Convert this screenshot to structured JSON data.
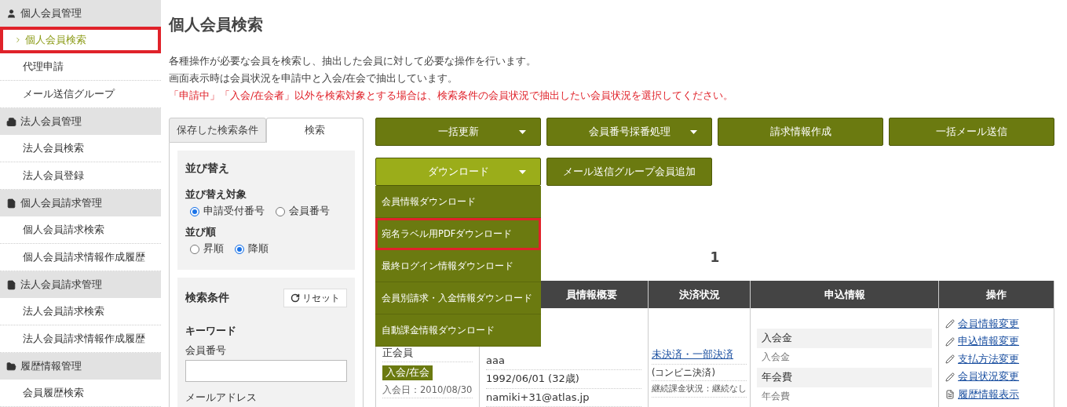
{
  "sidebar": {
    "groups": [
      {
        "label": "個人会員管理",
        "items": [
          {
            "label": "個人会員検索",
            "selected": true,
            "highlighted": true
          },
          {
            "label": "代理申請",
            "selected": false,
            "highlighted": false
          },
          {
            "label": "メール送信グループ",
            "selected": false,
            "highlighted": false
          }
        ]
      },
      {
        "label": "法人会員管理",
        "items": [
          {
            "label": "法人会員検索",
            "selected": false,
            "highlighted": false
          },
          {
            "label": "法人会員登録",
            "selected": false,
            "highlighted": false
          }
        ]
      },
      {
        "label": "個人会員請求管理",
        "items": [
          {
            "label": "個人会員請求検索",
            "selected": false,
            "highlighted": false
          },
          {
            "label": "個人会員請求情報作成履歴",
            "selected": false,
            "highlighted": false
          }
        ]
      },
      {
        "label": "法人会員請求管理",
        "items": [
          {
            "label": "法人会員請求検索",
            "selected": false,
            "highlighted": false
          },
          {
            "label": "法人会員請求情報作成履歴",
            "selected": false,
            "highlighted": false
          }
        ]
      },
      {
        "label": "履歴情報管理",
        "items": [
          {
            "label": "会員履歴検索",
            "selected": false,
            "highlighted": false
          }
        ]
      }
    ]
  },
  "page": {
    "title": "個人会員検索",
    "description": [
      "各種操作が必要な会員を検索し、抽出した会員に対して必要な操作を行います。",
      "画面表示時は会員状況を申請中と入会/在会で抽出しています。"
    ],
    "notice": "「申請中」「入会/在会者」以外を検索対象とする場合は、検索条件の会員状況で抽出したい会員状況を選択してください。"
  },
  "search_panel": {
    "tabs": [
      {
        "label": "保存した検索条件",
        "selected": false
      },
      {
        "label": "検索",
        "selected": true
      }
    ],
    "sort": {
      "title": "並び替え",
      "groups": [
        {
          "label": "並び替え対象",
          "options": [
            {
              "label": "申請受付番号",
              "selected": true
            },
            {
              "label": "会員番号",
              "selected": false
            }
          ]
        },
        {
          "label": "並び順",
          "options": [
            {
              "label": "昇順",
              "selected": false
            },
            {
              "label": "降順",
              "selected": true
            }
          ]
        }
      ]
    },
    "conditions": {
      "title": "検索条件",
      "reset_button": "リセット",
      "section": "キーワード",
      "fields": [
        {
          "label": "会員番号"
        }
      ],
      "next_label": "メールアドレス"
    }
  },
  "action_buttons": [
    [
      {
        "label": "一括更新",
        "dropdown": true,
        "open": false
      },
      {
        "label": "会員番号採番処理",
        "dropdown": true,
        "open": false
      },
      {
        "label": "請求情報作成",
        "dropdown": false,
        "open": false
      },
      {
        "label": "一括メール送信",
        "dropdown": false,
        "open": false
      }
    ],
    [
      {
        "label": "ダウンロード",
        "dropdown": true,
        "open": true
      },
      {
        "label": "メール送信グループ会員追加",
        "dropdown": false,
        "open": false
      }
    ]
  ],
  "download_menu": {
    "items": [
      {
        "label": "会員情報ダウンロード",
        "highlighted": false
      },
      {
        "label": "宛名ラベル用PDFダウンロード",
        "highlighted": true
      },
      {
        "label": "最終ログイン情報ダウンロード",
        "highlighted": false
      },
      {
        "label": "会員別請求・入金情報ダウンロード",
        "highlighted": false
      },
      {
        "label": "自動課金情報ダウンロード",
        "highlighted": false
      }
    ]
  },
  "pagination": {
    "current": "1"
  },
  "table": {
    "columns": [
      {},
      {
        "label": "員情報概要"
      },
      {
        "label": "決済状況"
      },
      {
        "label": "申込情報"
      },
      {
        "label": "操作"
      }
    ],
    "row": {
      "member_type": "正会員",
      "status_badge": "入会/在会",
      "joined": "入会日：2010/08/30",
      "profile": [
        "aaa",
        "1992/06/01 (32歳)",
        "namiki+31@atlas.jp"
      ],
      "payment": {
        "status_link": "未決済・一部決済",
        "method": "(コンビニ決済)",
        "recurring": "継続課金状況：継続なし"
      },
      "application": [
        {
          "heading": "入会金",
          "detail": "入会金"
        },
        {
          "heading": "年会費",
          "detail": "年会費"
        }
      ],
      "actions": [
        {
          "label": "会員情報変更",
          "kind": "edit"
        },
        {
          "label": "申込情報変更",
          "kind": "edit"
        },
        {
          "label": "支払方法変更",
          "kind": "edit"
        },
        {
          "label": "会員状況変更",
          "kind": "edit"
        },
        {
          "label": "履歴情報表示",
          "kind": "document"
        }
      ]
    }
  }
}
